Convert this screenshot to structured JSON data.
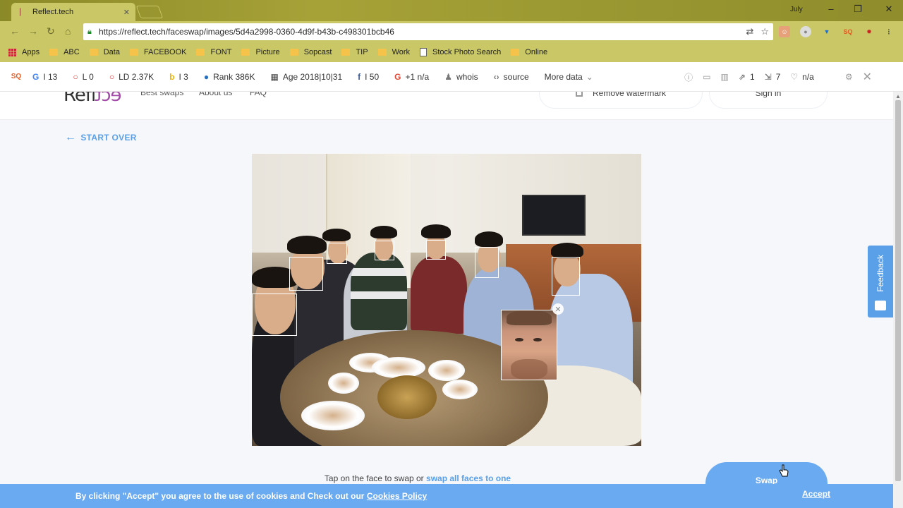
{
  "browser": {
    "tab_title": "Reflect.tech",
    "user_label": "July",
    "url": "https://reflect.tech/faceswap/images/5d4a2998-0360-4d9f-b43b-c498301bcb46",
    "bookmarks": [
      "Apps",
      "ABC",
      "Data",
      "FACEBOOK",
      "FONT",
      "Picture",
      "Sopcast",
      "TIP",
      "Work",
      "Stock Photo Search",
      "Online"
    ],
    "ext_sq": "SQ"
  },
  "seo": {
    "logo": "SQ",
    "google": "I 13",
    "l": "L 0",
    "ld": "LD 2.37K",
    "bing": "I 3",
    "rank": "Rank 386K",
    "age": "Age 2018|10|31",
    "fb": "I 50",
    "gplus": "+1 n/a",
    "whois": "whois",
    "source": "source",
    "more": "More data",
    "links_out": "1",
    "links_int": "7",
    "heart": "n/a"
  },
  "site": {
    "logo_left": "Refl",
    "logo_right": "ect",
    "nav": [
      "Best swaps",
      "About us",
      "FAQ"
    ],
    "remove_watermark": "Remove watermark",
    "sign_in": "Sign in",
    "start_over": "START OVER",
    "hint_prefix": "Tap on the face to swap or",
    "hint_link": "swap all faces to one",
    "swap_label": "Swap",
    "feedback_label": "Feedback",
    "cookie_text": "By clicking \"Accept\" you agree to the use of cookies and Check out our",
    "cookie_link": "Cookies Policy",
    "accept_label": "Accept"
  },
  "colors": {
    "accent": "#5aa0e8",
    "cookie_bar": "#6aaaf0",
    "chrome_frame": "#c9c766"
  }
}
